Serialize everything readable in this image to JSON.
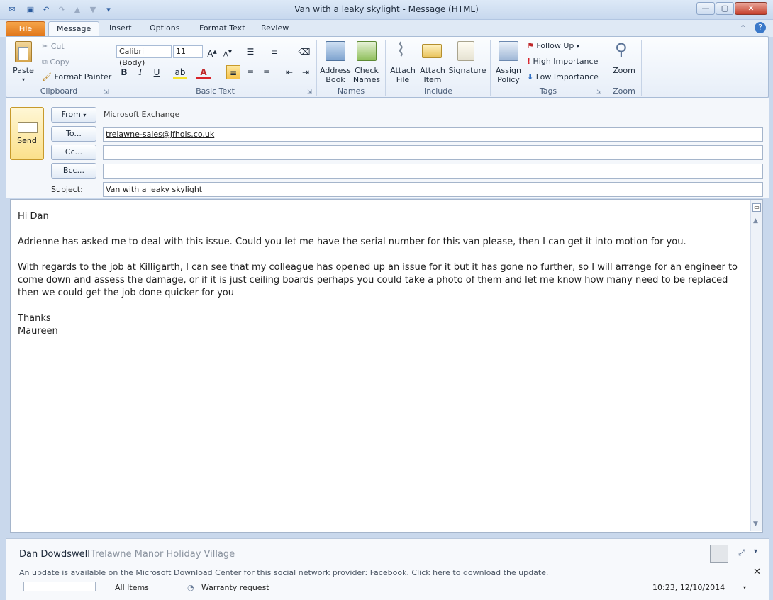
{
  "window": {
    "title": "Van with a leaky skylight  -  Message (HTML)",
    "buttons": {
      "minimize": "—",
      "maximize": "▢",
      "close": "✕"
    }
  },
  "tabs": [
    "File",
    "Message",
    "Insert",
    "Options",
    "Format Text",
    "Review"
  ],
  "ribbon": {
    "clipboard": {
      "paste": "Paste",
      "cut": "Cut",
      "copy": "Copy",
      "format_painter": "Format Painter",
      "label": "Clipboard"
    },
    "basic_text": {
      "font": "Calibri (Body)",
      "size": "11",
      "label": "Basic Text"
    },
    "names": {
      "address_book": [
        "Address",
        "Book"
      ],
      "check_names": [
        "Check",
        "Names"
      ],
      "label": "Names"
    },
    "include": {
      "attach_file": [
        "Attach",
        "File"
      ],
      "attach_item": [
        "Attach",
        "Item"
      ],
      "signature": "Signature",
      "label": "Include"
    },
    "tags": {
      "assign_policy": [
        "Assign",
        "Policy"
      ],
      "follow_up": "Follow Up",
      "high_importance": "High Importance",
      "low_importance": "Low Importance",
      "label": "Tags"
    },
    "zoom": {
      "zoom": "Zoom",
      "label": "Zoom"
    }
  },
  "compose": {
    "send": "Send",
    "from_btn": "From",
    "from_value": "Microsoft Exchange",
    "to_btn": "To...",
    "to_value": "trelawne-sales@jfhols.co.uk",
    "cc_btn": "Cc...",
    "cc_value": "",
    "bcc_btn": "Bcc...",
    "bcc_value": "",
    "subject_label": "Subject:",
    "subject_value": "Van with a leaky skylight"
  },
  "body": {
    "greeting": "Hi Dan",
    "p1": "Adrienne has asked me to deal with this issue.  Could you let me have the serial number for this van please, then I can get it into motion for you.",
    "p2": "With regards to the job at Killigarth, I can see that my colleague has opened up an issue for it but it has gone no further, so I will arrange for an engineer to come down and assess the damage, or if it is just ceiling boards perhaps you could take a photo of them and let me know how many need to be replaced then we could get the job done quicker for you",
    "closing1": "Thanks",
    "closing2": "Maureen"
  },
  "people_pane": {
    "name": "Dan Dowdswell",
    "company": "Trelawne Manor Holiday Village",
    "notice": "An update is available on the Microsoft Download Center for this social network provider: Facebook. Click here to download the update.",
    "row_left": "All Items",
    "row_subject": "Warranty request",
    "row_date": "10:23, 12/10/2014"
  }
}
